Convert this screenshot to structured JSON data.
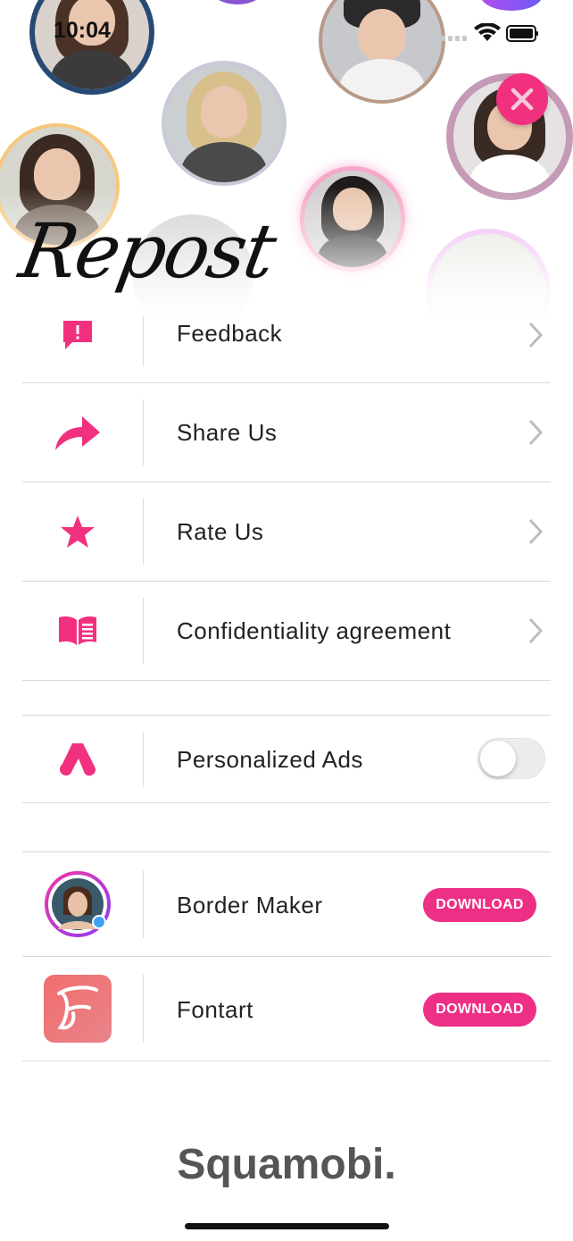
{
  "status_bar": {
    "time": "10:04"
  },
  "header": {
    "logo_text": "Repost",
    "close_icon": "close-icon"
  },
  "colors": {
    "accent": "#f1317f",
    "button": "#ee2f86",
    "divider": "#d9d9d9"
  },
  "menu": {
    "items": [
      {
        "label": "Feedback",
        "icon": "feedback-icon"
      },
      {
        "label": "Share Us",
        "icon": "share-icon"
      },
      {
        "label": "Rate Us",
        "icon": "star-icon"
      },
      {
        "label": "Confidentiality agreement",
        "icon": "book-icon"
      }
    ]
  },
  "settings": {
    "personalized_ads": {
      "label": "Personalized Ads",
      "icon": "ads-icon",
      "enabled": false
    }
  },
  "apps": [
    {
      "name": "Border Maker",
      "icon": "border-maker-app-icon",
      "button_label": "DOWNLOAD"
    },
    {
      "name": "Fontart",
      "icon": "fontart-app-icon",
      "button_label": "DOWNLOAD"
    }
  ],
  "footer": {
    "brand": "Squamobi."
  }
}
